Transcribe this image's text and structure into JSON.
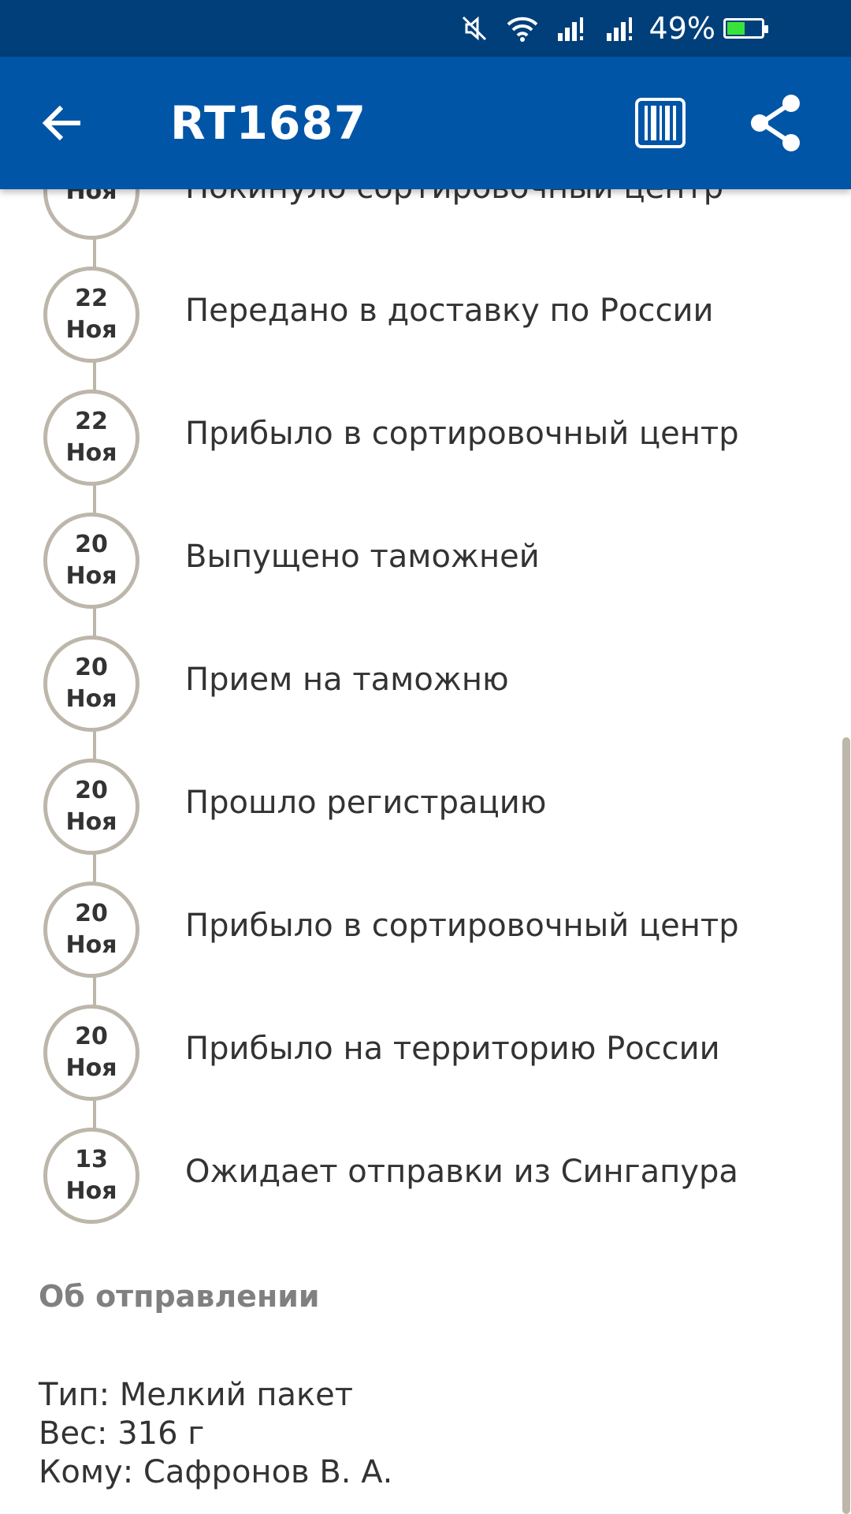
{
  "status_bar": {
    "battery_percent": "49%",
    "battery_level": 0.49,
    "battery_color": "#39e23a",
    "icons": [
      "mute-icon",
      "wifi-icon",
      "signal-icon",
      "signal-icon"
    ]
  },
  "app_bar": {
    "title": "RT1687",
    "color": "#0055a6"
  },
  "events": [
    {
      "day": "",
      "month": "Ноя",
      "text": "Покинуло сортировочный центр"
    },
    {
      "day": "22",
      "month": "Ноя",
      "text": "Передано в доставку по России"
    },
    {
      "day": "22",
      "month": "Ноя",
      "text": "Прибыло в сортировочный центр"
    },
    {
      "day": "20",
      "month": "Ноя",
      "text": "Выпущено таможней"
    },
    {
      "day": "20",
      "month": "Ноя",
      "text": "Прием на таможню"
    },
    {
      "day": "20",
      "month": "Ноя",
      "text": "Прошло регистрацию"
    },
    {
      "day": "20",
      "month": "Ноя",
      "text": "Прибыло в сортировочный центр"
    },
    {
      "day": "20",
      "month": "Ноя",
      "text": "Прибыло на территорию России"
    },
    {
      "day": "13",
      "month": "Ноя",
      "text": "Ожидает отправки из Сингапура"
    }
  ],
  "about": {
    "title": "Об отправлении",
    "type_line": "Тип: Мелкий пакет",
    "weight_line": "Вес: 316 г",
    "to_line": "Кому: Сафронов В. А."
  }
}
